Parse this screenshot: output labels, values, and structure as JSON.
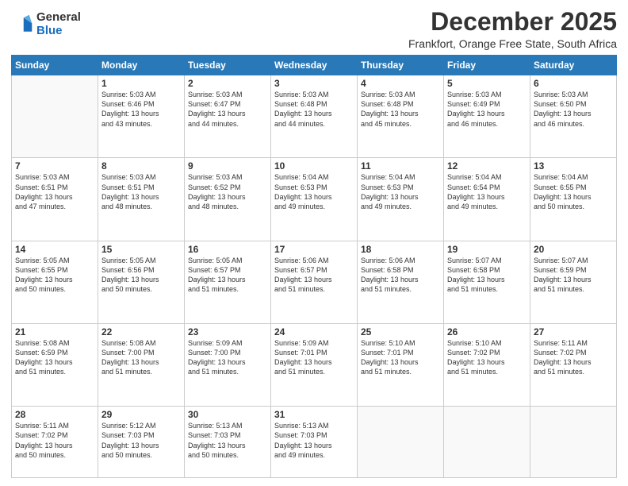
{
  "header": {
    "logo_general": "General",
    "logo_blue": "Blue",
    "month_title": "December 2025",
    "location": "Frankfort, Orange Free State, South Africa"
  },
  "weekdays": [
    "Sunday",
    "Monday",
    "Tuesday",
    "Wednesday",
    "Thursday",
    "Friday",
    "Saturday"
  ],
  "weeks": [
    [
      {
        "day": "",
        "info": ""
      },
      {
        "day": "1",
        "info": "Sunrise: 5:03 AM\nSunset: 6:46 PM\nDaylight: 13 hours\nand 43 minutes."
      },
      {
        "day": "2",
        "info": "Sunrise: 5:03 AM\nSunset: 6:47 PM\nDaylight: 13 hours\nand 44 minutes."
      },
      {
        "day": "3",
        "info": "Sunrise: 5:03 AM\nSunset: 6:48 PM\nDaylight: 13 hours\nand 44 minutes."
      },
      {
        "day": "4",
        "info": "Sunrise: 5:03 AM\nSunset: 6:48 PM\nDaylight: 13 hours\nand 45 minutes."
      },
      {
        "day": "5",
        "info": "Sunrise: 5:03 AM\nSunset: 6:49 PM\nDaylight: 13 hours\nand 46 minutes."
      },
      {
        "day": "6",
        "info": "Sunrise: 5:03 AM\nSunset: 6:50 PM\nDaylight: 13 hours\nand 46 minutes."
      }
    ],
    [
      {
        "day": "7",
        "info": "Sunrise: 5:03 AM\nSunset: 6:51 PM\nDaylight: 13 hours\nand 47 minutes."
      },
      {
        "day": "8",
        "info": "Sunrise: 5:03 AM\nSunset: 6:51 PM\nDaylight: 13 hours\nand 48 minutes."
      },
      {
        "day": "9",
        "info": "Sunrise: 5:03 AM\nSunset: 6:52 PM\nDaylight: 13 hours\nand 48 minutes."
      },
      {
        "day": "10",
        "info": "Sunrise: 5:04 AM\nSunset: 6:53 PM\nDaylight: 13 hours\nand 49 minutes."
      },
      {
        "day": "11",
        "info": "Sunrise: 5:04 AM\nSunset: 6:53 PM\nDaylight: 13 hours\nand 49 minutes."
      },
      {
        "day": "12",
        "info": "Sunrise: 5:04 AM\nSunset: 6:54 PM\nDaylight: 13 hours\nand 49 minutes."
      },
      {
        "day": "13",
        "info": "Sunrise: 5:04 AM\nSunset: 6:55 PM\nDaylight: 13 hours\nand 50 minutes."
      }
    ],
    [
      {
        "day": "14",
        "info": "Sunrise: 5:05 AM\nSunset: 6:55 PM\nDaylight: 13 hours\nand 50 minutes."
      },
      {
        "day": "15",
        "info": "Sunrise: 5:05 AM\nSunset: 6:56 PM\nDaylight: 13 hours\nand 50 minutes."
      },
      {
        "day": "16",
        "info": "Sunrise: 5:05 AM\nSunset: 6:57 PM\nDaylight: 13 hours\nand 51 minutes."
      },
      {
        "day": "17",
        "info": "Sunrise: 5:06 AM\nSunset: 6:57 PM\nDaylight: 13 hours\nand 51 minutes."
      },
      {
        "day": "18",
        "info": "Sunrise: 5:06 AM\nSunset: 6:58 PM\nDaylight: 13 hours\nand 51 minutes."
      },
      {
        "day": "19",
        "info": "Sunrise: 5:07 AM\nSunset: 6:58 PM\nDaylight: 13 hours\nand 51 minutes."
      },
      {
        "day": "20",
        "info": "Sunrise: 5:07 AM\nSunset: 6:59 PM\nDaylight: 13 hours\nand 51 minutes."
      }
    ],
    [
      {
        "day": "21",
        "info": "Sunrise: 5:08 AM\nSunset: 6:59 PM\nDaylight: 13 hours\nand 51 minutes."
      },
      {
        "day": "22",
        "info": "Sunrise: 5:08 AM\nSunset: 7:00 PM\nDaylight: 13 hours\nand 51 minutes."
      },
      {
        "day": "23",
        "info": "Sunrise: 5:09 AM\nSunset: 7:00 PM\nDaylight: 13 hours\nand 51 minutes."
      },
      {
        "day": "24",
        "info": "Sunrise: 5:09 AM\nSunset: 7:01 PM\nDaylight: 13 hours\nand 51 minutes."
      },
      {
        "day": "25",
        "info": "Sunrise: 5:10 AM\nSunset: 7:01 PM\nDaylight: 13 hours\nand 51 minutes."
      },
      {
        "day": "26",
        "info": "Sunrise: 5:10 AM\nSunset: 7:02 PM\nDaylight: 13 hours\nand 51 minutes."
      },
      {
        "day": "27",
        "info": "Sunrise: 5:11 AM\nSunset: 7:02 PM\nDaylight: 13 hours\nand 51 minutes."
      }
    ],
    [
      {
        "day": "28",
        "info": "Sunrise: 5:11 AM\nSunset: 7:02 PM\nDaylight: 13 hours\nand 50 minutes."
      },
      {
        "day": "29",
        "info": "Sunrise: 5:12 AM\nSunset: 7:03 PM\nDaylight: 13 hours\nand 50 minutes."
      },
      {
        "day": "30",
        "info": "Sunrise: 5:13 AM\nSunset: 7:03 PM\nDaylight: 13 hours\nand 50 minutes."
      },
      {
        "day": "31",
        "info": "Sunrise: 5:13 AM\nSunset: 7:03 PM\nDaylight: 13 hours\nand 49 minutes."
      },
      {
        "day": "",
        "info": ""
      },
      {
        "day": "",
        "info": ""
      },
      {
        "day": "",
        "info": ""
      }
    ]
  ]
}
